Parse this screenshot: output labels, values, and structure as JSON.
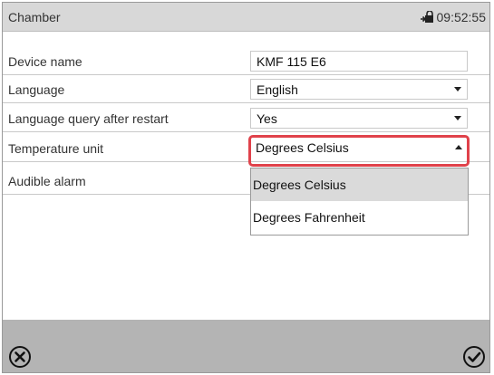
{
  "header": {
    "title": "Chamber",
    "time": "09:52:55",
    "lock_icon": "lock-icon"
  },
  "rows": [
    {
      "label": "Device name",
      "value": "KMF 115 E6",
      "type": "text"
    },
    {
      "label": "Language",
      "value": "English",
      "type": "select"
    },
    {
      "label": "Language query after restart",
      "value": "Yes",
      "type": "select"
    },
    {
      "label": "Temperature unit",
      "value": "Degrees Celsius",
      "type": "select-open"
    },
    {
      "label": "Audible alarm"
    }
  ],
  "dropdown": {
    "options": [
      "Degrees Celsius",
      "Degrees Fahrenheit"
    ],
    "selected_index": 0
  },
  "footer": {
    "cancel_icon": "close-circle-icon",
    "confirm_icon": "check-circle-icon"
  },
  "colors": {
    "header_bg": "#d8d8d8",
    "footer_bg": "#b4b4b4",
    "highlight": "#e0424b",
    "selected_option_bg": "#dadada"
  }
}
